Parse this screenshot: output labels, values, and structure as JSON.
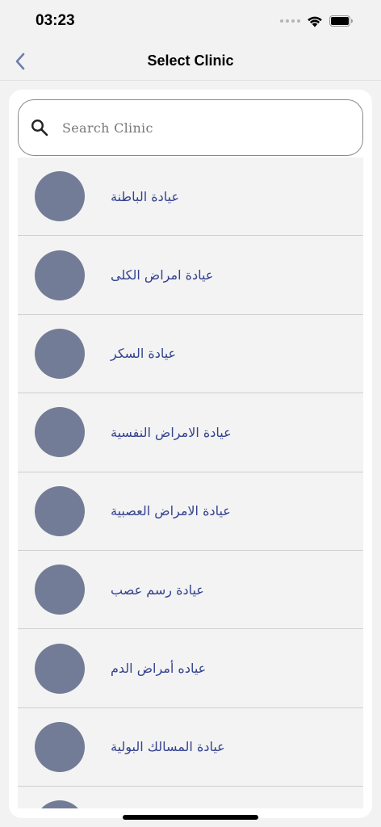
{
  "status_bar": {
    "time": "03:23"
  },
  "nav": {
    "title": "Select Clinic",
    "back_icon": "chevron-left-icon"
  },
  "search": {
    "placeholder": "Search Clinic",
    "value": "",
    "icon": "search-icon"
  },
  "colors": {
    "accent": "#6e7fa8",
    "avatar": "#737c97",
    "clinic_text": "#33428f"
  },
  "clinics": [
    {
      "name": "عيادة الباطنة"
    },
    {
      "name": "عيادة امراض الكلى"
    },
    {
      "name": "عيادة السكر"
    },
    {
      "name": "عيادة الامراض النفسية"
    },
    {
      "name": "عيادة الامراض العصبية"
    },
    {
      "name": "عيادة رسم عصب"
    },
    {
      "name": "عياده أمراض الدم"
    },
    {
      "name": "عيادة المسالك البولية"
    },
    {
      "name": ""
    }
  ]
}
